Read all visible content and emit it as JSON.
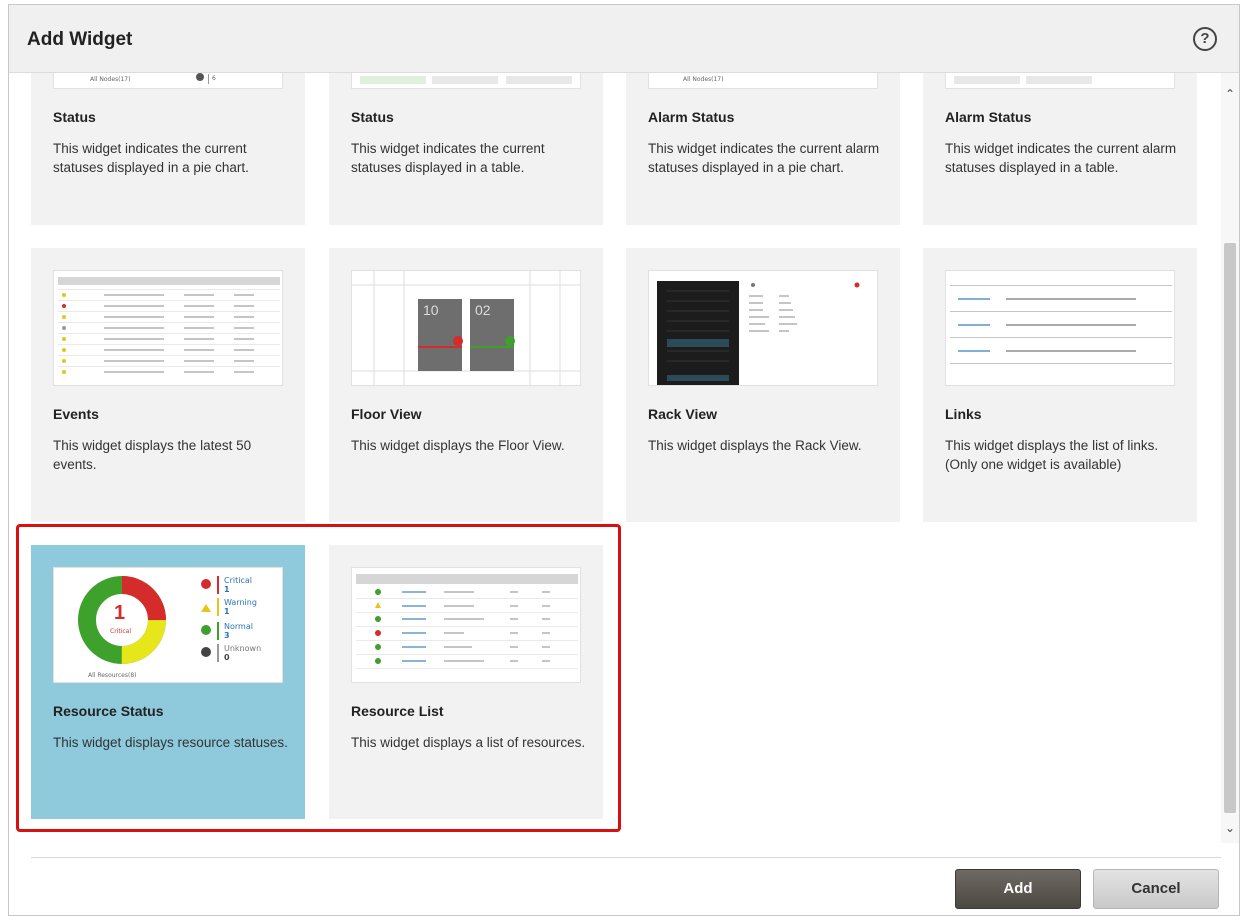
{
  "dialog": {
    "title": "Add Widget",
    "help_glyph": "?"
  },
  "widgets": [
    {
      "title": "Status",
      "description": "This widget indicates the current statuses displayed in a pie chart.",
      "thumb_caption": "All Nodes(17)",
      "thumb_value": "6"
    },
    {
      "title": "Status",
      "description": "This widget indicates the current statuses displayed in a table."
    },
    {
      "title": "Alarm Status",
      "description": "This widget indicates the current alarm statuses displayed in a pie chart.",
      "thumb_caption": "All Nodes(17)"
    },
    {
      "title": "Alarm Status",
      "description": "This widget indicates the current alarm statuses displayed in a table."
    },
    {
      "title": "Events",
      "description": "This widget displays the latest 50 events."
    },
    {
      "title": "Floor View",
      "description": "This widget displays the Floor View.",
      "thumb_racks": [
        "10",
        "02"
      ]
    },
    {
      "title": "Rack View",
      "description": "This widget displays the Rack View."
    },
    {
      "title": "Links",
      "description": "This widget displays the list of links. (Only one widget is available)"
    },
    {
      "title": "Resource Status",
      "description": "This widget displays resource statuses.",
      "selected": true,
      "thumb": {
        "center_value": "1",
        "center_label": "Critical",
        "caption": "All Resources(8)",
        "legend": [
          {
            "label": "Critical",
            "value": "1",
            "icon": "error-icon",
            "color": "#d62b2b"
          },
          {
            "label": "Warning",
            "value": "1",
            "icon": "warning-icon",
            "color": "#e6c51a"
          },
          {
            "label": "Normal",
            "value": "3",
            "icon": "check-icon",
            "color": "#3da12b"
          },
          {
            "label": "Unknown",
            "value": "0",
            "icon": "question-icon",
            "color": "#444444"
          }
        ]
      }
    },
    {
      "title": "Resource List",
      "description": "This widget displays a list of resources."
    }
  ],
  "footer": {
    "add_label": "Add",
    "cancel_label": "Cancel"
  },
  "colors": {
    "selected_card": "#8ec9dc",
    "highlight_border": "#d81010",
    "critical": "#d62b2b",
    "warning": "#e6c51a",
    "normal": "#3da12b"
  }
}
